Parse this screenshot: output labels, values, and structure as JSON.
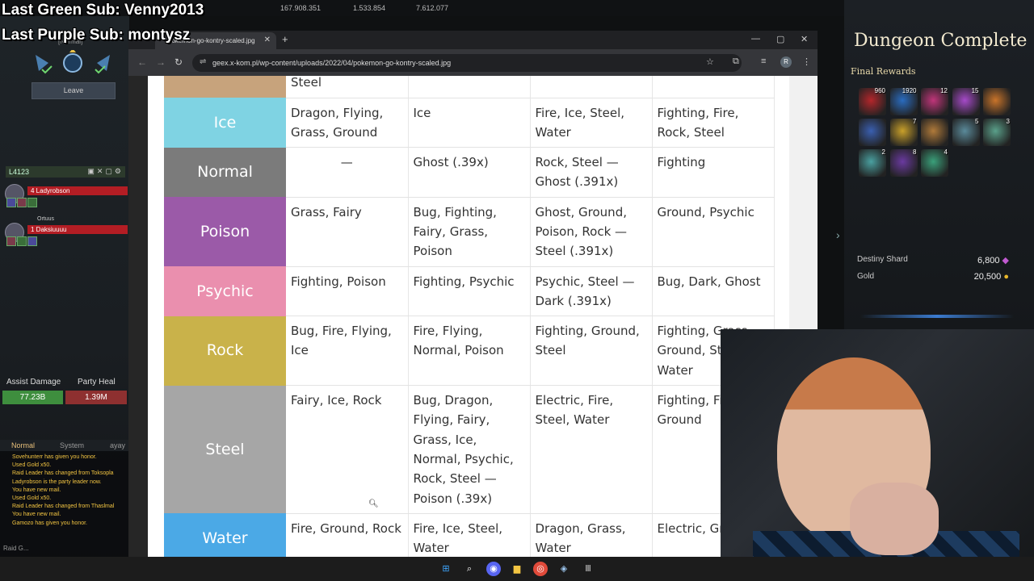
{
  "overlay": {
    "last_green_sub": "Last Green Sub: Venny2013",
    "last_purple_sub": "Last Purple Sub: montysz"
  },
  "game_hud": {
    "top_stats": [
      "167.908.351",
      "1.533.854",
      "7.612.077"
    ],
    "difficulty": "[Normal]",
    "leave_label": "Leave",
    "party_label": "L4123",
    "members": [
      {
        "title": "",
        "name": "4 Ladyrobson"
      },
      {
        "title": "Ortuus",
        "name": "1 Daksiuuuu"
      }
    ],
    "assist_damage_label": "Assist Damage",
    "assist_damage_value": "77.23B",
    "party_heal_label": "Party Heal",
    "party_heal_value": "1.39M",
    "chat_tabs": [
      "Normal",
      "System",
      "ayay"
    ],
    "chat_lines": [
      "Sovehunterr has given you honor.",
      "Used Gold x50.",
      "Raid Leader has changed from Toksopla",
      "Ladyrobson is the party leader now.",
      "You have new mail.",
      "Used Gold x50.",
      "Raid Leader has changed from Thaslmal",
      "You have new mail.",
      "Gamozo has given you honor."
    ],
    "chat_input": "Raid G..."
  },
  "browser": {
    "tab_title": "pokemon-go-kontry-scaled.jpg",
    "url": "geex.x-kom.pl/wp-content/uploads/2022/04/pokemon-go-kontry-scaled.jpg",
    "profile_initial": "R"
  },
  "type_table": {
    "colors": {
      "Ground": "#c7a37c",
      "Ice": "#7fd3e3",
      "Normal": "#7b7b7b",
      "Poison": "#9b5aa8",
      "Psychic": "#ea8fae",
      "Rock": "#c9b24a",
      "Steel": "#a6a6a6",
      "Water": "#4ba9e6"
    },
    "rows": [
      {
        "type": "",
        "color_key": "Ground",
        "c1": "Steel",
        "c2": "",
        "c3": "",
        "c4": ""
      },
      {
        "type": "Ice",
        "color_key": "Ice",
        "c1": "Dragon, Flying, Grass, Ground",
        "c2": "Ice",
        "c3": "Fire, Ice, Steel, Water",
        "c4": "Fighting, Fire, Rock, Steel"
      },
      {
        "type": "Normal",
        "color_key": "Normal",
        "c1": "—",
        "c2": "Ghost (.39x)",
        "c3": "Rock, Steel — Ghost (.391x)",
        "c4": "Fighting"
      },
      {
        "type": "Poison",
        "color_key": "Poison",
        "c1": "Grass, Fairy",
        "c2": "Bug, Fighting, Fairy, Grass, Poison",
        "c3": "Ghost, Ground, Poison, Rock — Steel (.391x)",
        "c4": "Ground, Psychic"
      },
      {
        "type": "Psychic",
        "color_key": "Psychic",
        "c1": "Fighting, Poison",
        "c2": "Fighting, Psychic",
        "c3": "Psychic, Steel — Dark (.391x)",
        "c4": "Bug, Dark, Ghost"
      },
      {
        "type": "Rock",
        "color_key": "Rock",
        "c1": "Bug, Fire, Flying, Ice",
        "c2": "Fire, Flying, Normal, Poison",
        "c3": "Fighting, Ground, Steel",
        "c4": "Fighting, Grass, Ground, Steel, Water"
      },
      {
        "type": "Steel",
        "color_key": "Steel",
        "c1": "Fairy, Ice, Rock",
        "c2": "Bug, Dragon, Flying, Fairy, Grass, Ice, Normal, Psychic, Rock, Steel — Poison (.39x)",
        "c3": "Electric, Fire, Steel, Water",
        "c4": "Fighting, Fire, Ground"
      },
      {
        "type": "Water",
        "color_key": "Water",
        "c1": "Fire, Ground, Rock",
        "c2": "Fire, Ice, Steel, Water",
        "c3": "Dragon, Grass, Water",
        "c4": "Electric, Grass"
      }
    ]
  },
  "dungeon": {
    "title": "Dungeon Complete",
    "final_rewards_label": "Final Rewards",
    "rewards": [
      {
        "count": "960",
        "color": "#b4262b"
      },
      {
        "count": "1920",
        "color": "#2a6cc0"
      },
      {
        "count": "12",
        "color": "#c0357a"
      },
      {
        "count": "15",
        "color": "#a64ac9"
      },
      {
        "count": "",
        "color": "#c9742a"
      },
      {
        "count": "",
        "color": "#3a5fb0"
      },
      {
        "count": "7",
        "color": "#c9a02a"
      },
      {
        "count": "",
        "color": "#b07a3a"
      },
      {
        "count": "5",
        "color": "#5a8a9a"
      },
      {
        "count": "3",
        "color": "#5aa08a"
      },
      {
        "count": "2",
        "color": "#4aa0a0"
      },
      {
        "count": "8",
        "color": "#6a3aa0"
      },
      {
        "count": "4",
        "color": "#3aa07a"
      }
    ],
    "destiny_shard_label": "Destiny Shard",
    "destiny_shard_value": "6,800",
    "gold_label": "Gold",
    "gold_value": "20,500"
  }
}
